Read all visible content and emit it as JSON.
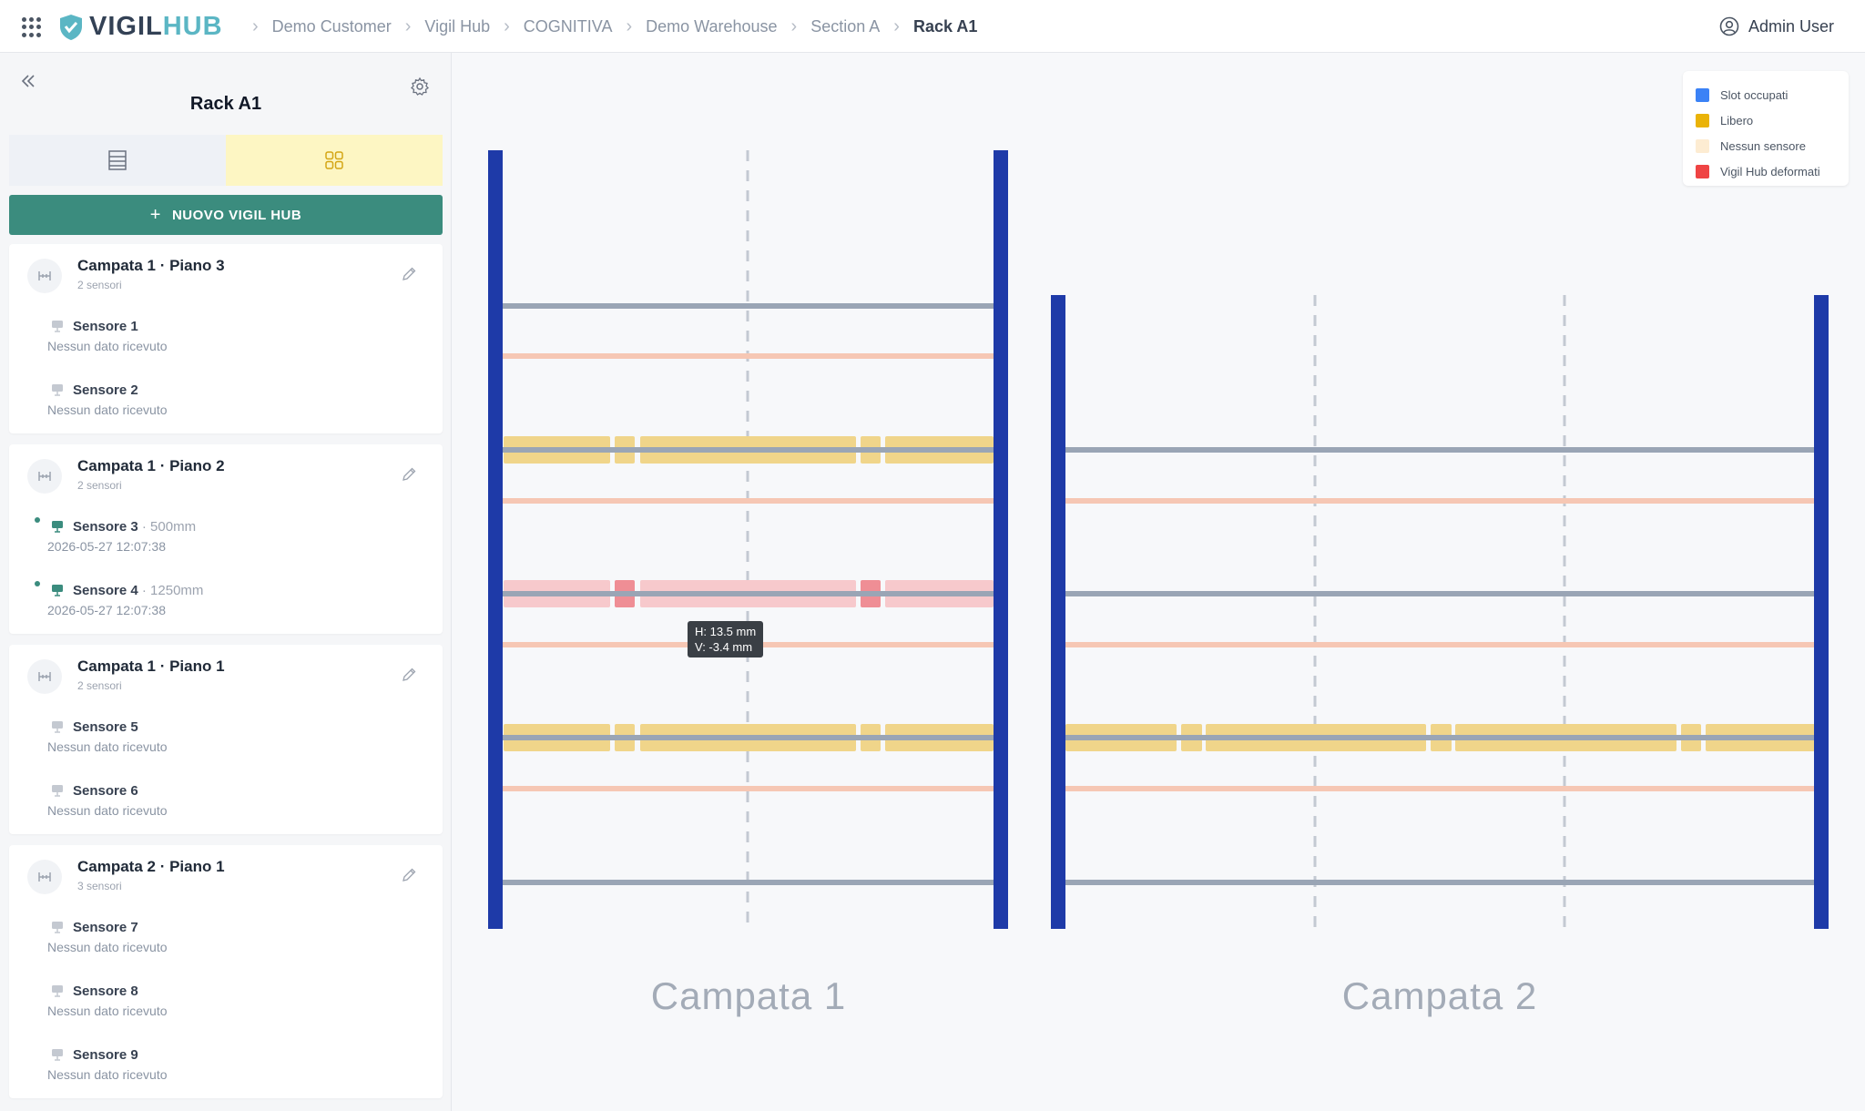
{
  "header": {
    "apps_icon": "grid-dots-icon",
    "logo_part1": "VIGIL",
    "logo_part2": "HUB",
    "breadcrumbs": [
      "Demo Customer",
      "Vigil Hub",
      "COGNITIVA",
      "Demo Warehouse",
      "Section A",
      "Rack A1"
    ],
    "user_name": "Admin User",
    "user_icon": "user-circle-icon"
  },
  "sidebar": {
    "title": "Rack A1",
    "collapse_icon": "chevrons-left-icon",
    "settings_icon": "gear-icon",
    "tab_list_icon": "list-view-icon",
    "tab_grid_icon": "grid-view-icon",
    "new_button_label": "NUOVO VIGIL HUB",
    "cards": [
      {
        "title": "Campata 1 · Piano 3",
        "subtitle": "2 sensori",
        "sensors": [
          {
            "name": "Sensore 1",
            "value": "",
            "status": "Nessun dato ricevuto",
            "active": false
          },
          {
            "name": "Sensore 2",
            "value": "",
            "status": "Nessun dato ricevuto",
            "active": false
          }
        ]
      },
      {
        "title": "Campata 1 · Piano 2",
        "subtitle": "2 sensori",
        "sensors": [
          {
            "name": "Sensore 3",
            "value": " · 500mm",
            "status": "2026-05-27 12:07:38",
            "active": true
          },
          {
            "name": "Sensore 4",
            "value": " · 1250mm",
            "status": "2026-05-27 12:07:38",
            "active": true
          }
        ]
      },
      {
        "title": "Campata 1 · Piano 1",
        "subtitle": "2 sensori",
        "sensors": [
          {
            "name": "Sensore 5",
            "value": "",
            "status": "Nessun dato ricevuto",
            "active": false
          },
          {
            "name": "Sensore 6",
            "value": "",
            "status": "Nessun dato ricevuto",
            "active": false
          }
        ]
      },
      {
        "title": "Campata 2 · Piano 1",
        "subtitle": "3 sensori",
        "sensors": [
          {
            "name": "Sensore 7",
            "value": "",
            "status": "Nessun dato ricevuto",
            "active": false
          },
          {
            "name": "Sensore 8",
            "value": "",
            "status": "Nessun dato ricevuto",
            "active": false
          },
          {
            "name": "Sensore 9",
            "value": "",
            "status": "Nessun dato ricevuto",
            "active": false
          }
        ]
      }
    ]
  },
  "legend": [
    {
      "label": "Slot occupati",
      "color": "#3b82f6"
    },
    {
      "label": "Libero",
      "color": "#eab308"
    },
    {
      "label": "Nessun sensore",
      "color": "#fdecd2"
    },
    {
      "label": "Vigil Hub deformati",
      "color": "#ef4444"
    }
  ],
  "tooltip": {
    "line1": "H: 13.5 mm",
    "line2": "V: -3.4 mm"
  },
  "rack": {
    "bays": [
      {
        "label": "Campata 1",
        "subdivisions": 2
      },
      {
        "label": "Campata 2",
        "subdivisions": 3
      }
    ],
    "colors": {
      "upright": "#1e3aa8",
      "beam": "#9aa5b5",
      "beam_pink": "#f6c7b4",
      "slot_yellow": "#f0d58a",
      "slot_red": "#f7c9cc",
      "slot_red_small": "#ef8e95",
      "divider": "#c3c9d2",
      "bay_label": "#a3abb7"
    }
  }
}
